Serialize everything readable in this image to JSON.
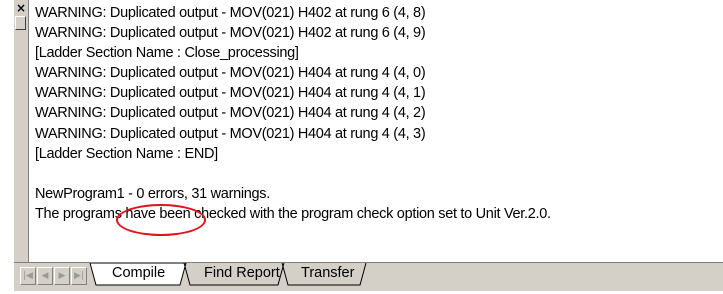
{
  "window": {
    "close_glyph": "×"
  },
  "log": {
    "lines": [
      "WARNING: Duplicated output -  MOV(021) H402 at rung 6 (4, 8)",
      "WARNING: Duplicated output -  MOV(021) H402 at rung 6 (4, 9)",
      "[Ladder Section Name : Close_processing]",
      "WARNING: Duplicated output -  MOV(021) H404 at rung 4 (4, 0)",
      "WARNING: Duplicated output -  MOV(021) H404 at rung 4 (4, 1)",
      "WARNING: Duplicated output -  MOV(021) H404 at rung 4 (4, 2)",
      "WARNING: Duplicated output -  MOV(021) H404 at rung 4 (4, 3)",
      "[Ladder Section Name : END]",
      "",
      "NewProgram1 - 0 errors, 31 warnings.",
      "The programs have been checked with the program check option set to Unit Ver.2.0."
    ]
  },
  "tabs": [
    {
      "label": "Compile",
      "active": true
    },
    {
      "label": "Find Report",
      "active": false
    },
    {
      "label": "Transfer",
      "active": false
    }
  ],
  "nav": {
    "first": "|◀",
    "prev": "◀",
    "next": "▶",
    "last": "▶|"
  },
  "colors": {
    "highlight": "#e0141b",
    "chrome": "#d4d0c8"
  },
  "icons": [
    "close-icon",
    "first-tab-icon",
    "prev-tab-icon",
    "next-tab-icon",
    "last-tab-icon"
  ]
}
